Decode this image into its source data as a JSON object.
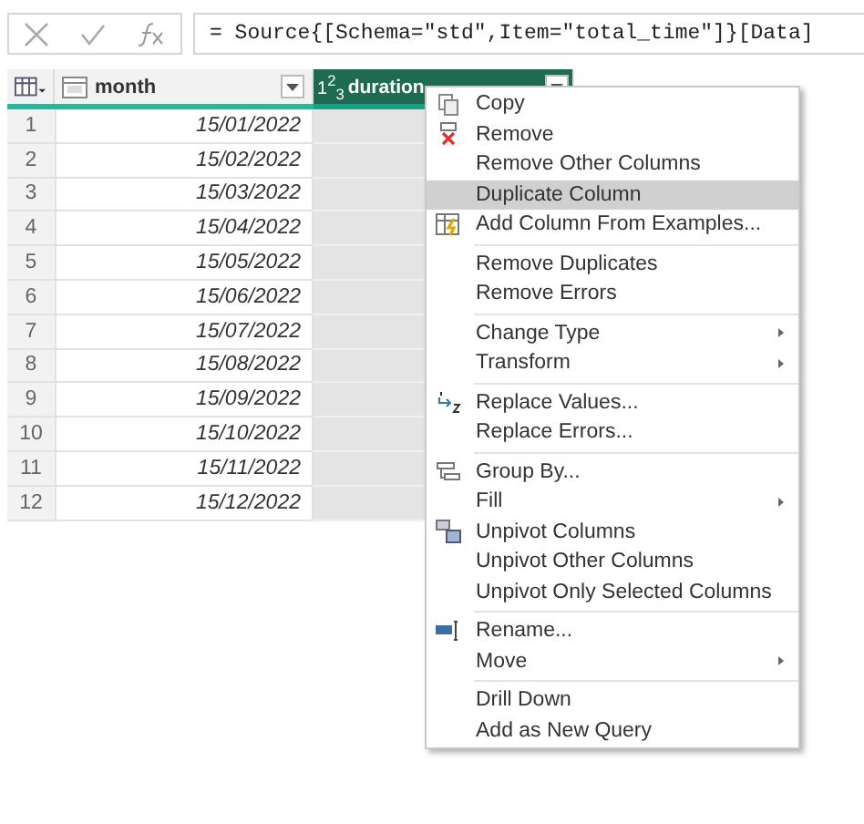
{
  "formula_bar": {
    "formula": "= Source{[Schema=\"std\",Item=\"total_time\"]}[Data]"
  },
  "table": {
    "columns": [
      {
        "label": "month",
        "kind": "date",
        "selected": false
      },
      {
        "label": "duration",
        "kind": "number",
        "type_label": "1$^{2}$$_{3}$",
        "selected": true
      }
    ],
    "rows": [
      {
        "number": "1",
        "month": "15/01/2022"
      },
      {
        "number": "2",
        "month": "15/02/2022"
      },
      {
        "number": "3",
        "month": "15/03/2022"
      },
      {
        "number": "4",
        "month": "15/04/2022"
      },
      {
        "number": "5",
        "month": "15/05/2022"
      },
      {
        "number": "6",
        "month": "15/06/2022"
      },
      {
        "number": "7",
        "month": "15/07/2022"
      },
      {
        "number": "8",
        "month": "15/08/2022"
      },
      {
        "number": "9",
        "month": "15/09/2022"
      },
      {
        "number": "10",
        "month": "15/10/2022"
      },
      {
        "number": "11",
        "month": "15/11/2022"
      },
      {
        "number": "12",
        "month": "15/12/2022"
      }
    ]
  },
  "context_menu": {
    "groups": [
      [
        {
          "label": "Copy",
          "highlighted": false,
          "submenu": false
        },
        {
          "label": "Remove",
          "highlighted": false,
          "submenu": false
        },
        {
          "label": "Remove Other Columns",
          "highlighted": false,
          "submenu": false
        },
        {
          "label": "Duplicate Column",
          "highlighted": true,
          "submenu": false
        },
        {
          "label": "Add Column From Examples...",
          "highlighted": false,
          "submenu": false
        }
      ],
      [
        {
          "label": "Remove Duplicates",
          "highlighted": false,
          "submenu": false
        },
        {
          "label": "Remove Errors",
          "highlighted": false,
          "submenu": false
        }
      ],
      [
        {
          "label": "Change Type",
          "highlighted": false,
          "submenu": true
        },
        {
          "label": "Transform",
          "highlighted": false,
          "submenu": true
        }
      ],
      [
        {
          "label": "Replace Values...",
          "highlighted": false,
          "submenu": false
        },
        {
          "label": "Replace Errors...",
          "highlighted": false,
          "submenu": false
        }
      ],
      [
        {
          "label": "Group By...",
          "highlighted": false,
          "submenu": false
        },
        {
          "label": "Fill",
          "highlighted": false,
          "submenu": true
        },
        {
          "label": "Unpivot Columns",
          "highlighted": false,
          "submenu": false
        },
        {
          "label": "Unpivot Other Columns",
          "highlighted": false,
          "submenu": false
        },
        {
          "label": "Unpivot Only Selected Columns",
          "highlighted": false,
          "submenu": false
        }
      ],
      [
        {
          "label": "Rename...",
          "highlighted": false,
          "submenu": false
        },
        {
          "label": "Move",
          "highlighted": false,
          "submenu": true
        }
      ],
      [
        {
          "label": "Drill Down",
          "highlighted": false,
          "submenu": false
        },
        {
          "label": "Add as New Query",
          "highlighted": false,
          "submenu": false
        }
      ]
    ]
  }
}
